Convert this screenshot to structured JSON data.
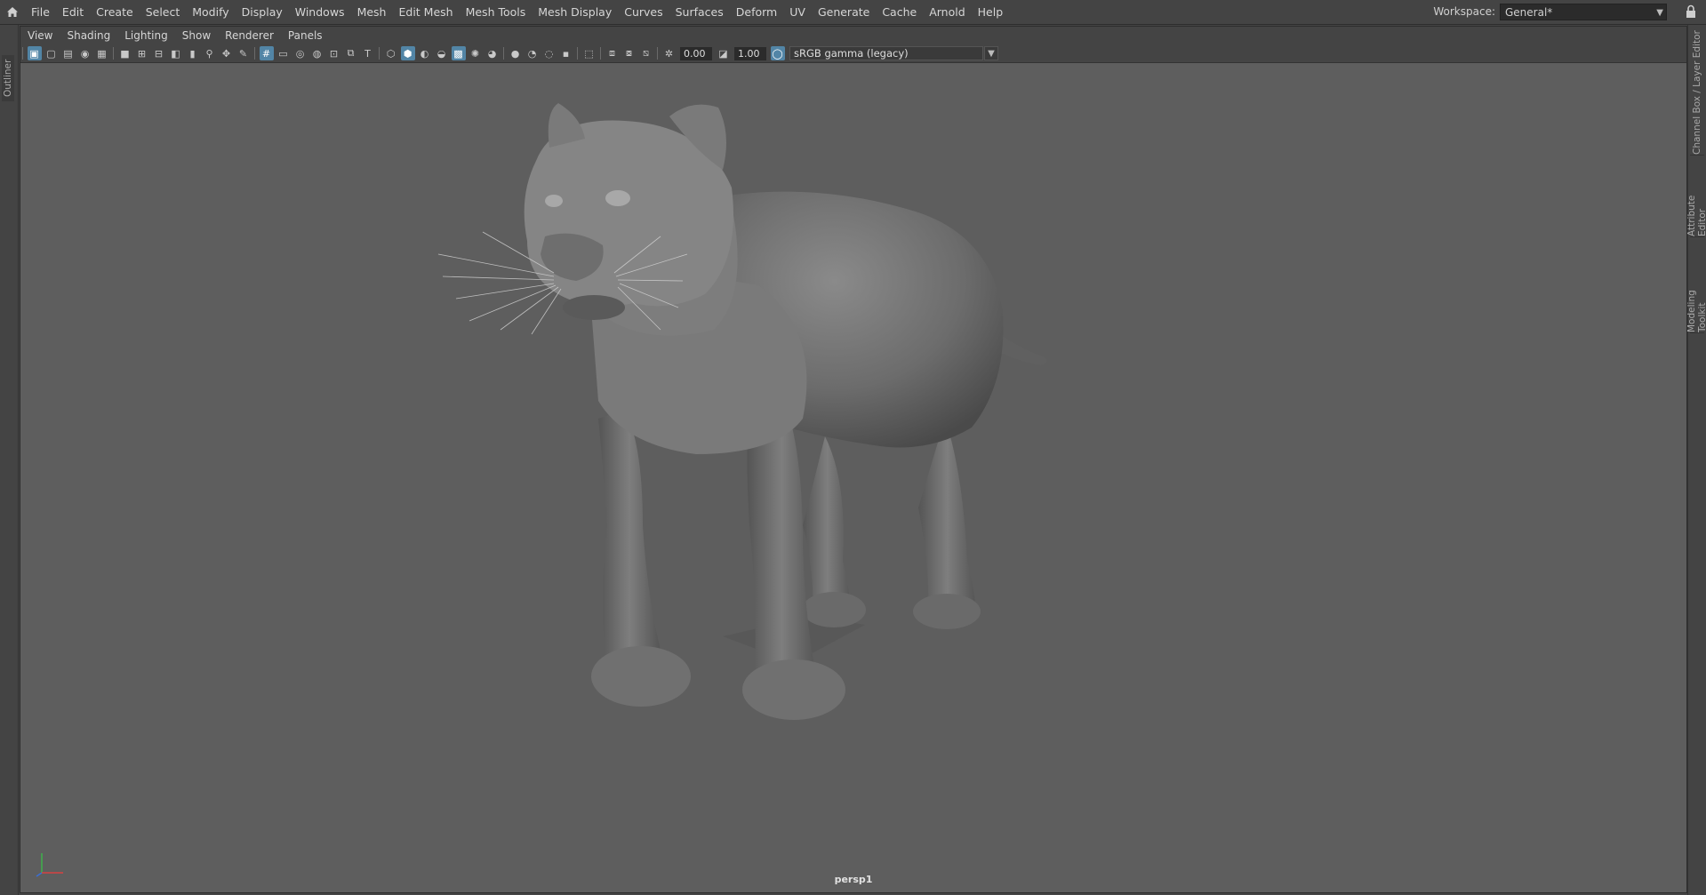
{
  "menubar": {
    "items": [
      "File",
      "Edit",
      "Create",
      "Select",
      "Modify",
      "Display",
      "Windows",
      "Mesh",
      "Edit Mesh",
      "Mesh Tools",
      "Mesh Display",
      "Curves",
      "Surfaces",
      "Deform",
      "UV",
      "Generate",
      "Cache",
      "Arnold",
      "Help"
    ],
    "workspace_label": "Workspace:",
    "workspace_value": "General*"
  },
  "left_tabs": {
    "outliner": "Outliner"
  },
  "right_tabs": {
    "channel_box": "Channel Box / Layer Editor",
    "attribute_editor": "Attribute Editor",
    "modeling_toolkit": "Modeling Toolkit"
  },
  "panel": {
    "menus": [
      "View",
      "Shading",
      "Lighting",
      "Show",
      "Renderer",
      "Panels"
    ],
    "exposure_value": "0.00",
    "gamma_value": "1.00",
    "color_space": "sRGB gamma (legacy)",
    "camera": "persp1"
  },
  "colors": {
    "ui_bg": "#444444",
    "viewport_bg": "#5e5e5e",
    "accent": "#5285a6"
  }
}
